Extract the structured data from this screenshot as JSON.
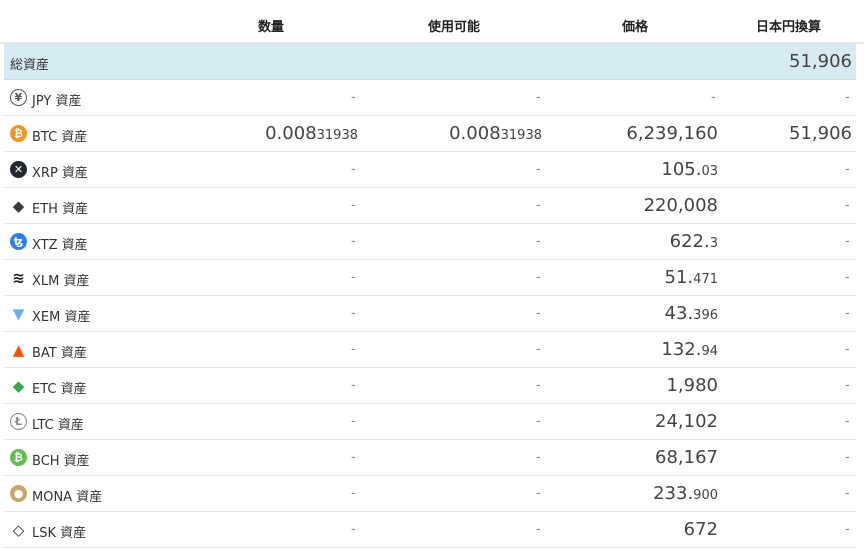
{
  "columns": {
    "quantity": "数量",
    "available": "使用可能",
    "price": "価格",
    "jpy_value": "日本円換算"
  },
  "total": {
    "label": "総資産",
    "jpy_value": "51,906"
  },
  "asset_suffix": "資産",
  "dash": "-",
  "assets": [
    {
      "symbol": "JPY",
      "icon": "yen-icon",
      "color": "#ffffff",
      "qty": null,
      "avail": null,
      "price_main": null,
      "price_small": null,
      "jpy": null
    },
    {
      "symbol": "BTC",
      "icon": "bitcoin-icon",
      "color": "#f7931a",
      "qty_main": "0.008",
      "qty_small": "31938",
      "avail_main": "0.008",
      "avail_small": "31938",
      "price_main": "6,239,160",
      "price_small": "",
      "jpy": "51,906"
    },
    {
      "symbol": "XRP",
      "icon": "xrp-icon",
      "color": "#23292f",
      "price_main": "105.",
      "price_small": "03"
    },
    {
      "symbol": "ETH",
      "icon": "ethereum-icon",
      "color": "#3c3c3d",
      "price_main": "220,008",
      "price_small": ""
    },
    {
      "symbol": "XTZ",
      "icon": "tezos-icon",
      "color": "#2c7df7",
      "price_main": "622.",
      "price_small": "3"
    },
    {
      "symbol": "XLM",
      "icon": "stellar-icon",
      "color": "#222222",
      "price_main": "51.",
      "price_small": "471"
    },
    {
      "symbol": "XEM",
      "icon": "nem-icon",
      "color": "#67b2e8",
      "price_main": "43.",
      "price_small": "396"
    },
    {
      "symbol": "BAT",
      "icon": "bat-icon",
      "color": "#ff5000",
      "price_main": "132.",
      "price_small": "94"
    },
    {
      "symbol": "ETC",
      "icon": "ethereum-classic-icon",
      "color": "#34a853",
      "price_main": "1,980",
      "price_small": ""
    },
    {
      "symbol": "LTC",
      "icon": "litecoin-icon",
      "color": "#a6a9aa",
      "price_main": "24,102",
      "price_small": ""
    },
    {
      "symbol": "BCH",
      "icon": "bitcoin-cash-icon",
      "color": "#5fbf4b",
      "price_main": "68,167",
      "price_small": ""
    },
    {
      "symbol": "MONA",
      "icon": "monacoin-icon",
      "color": "#c9a56b",
      "price_main": "233.",
      "price_small": "900"
    },
    {
      "symbol": "LSK",
      "icon": "lisk-icon",
      "color": "#1a2a47",
      "price_main": "672",
      "price_small": ""
    }
  ]
}
